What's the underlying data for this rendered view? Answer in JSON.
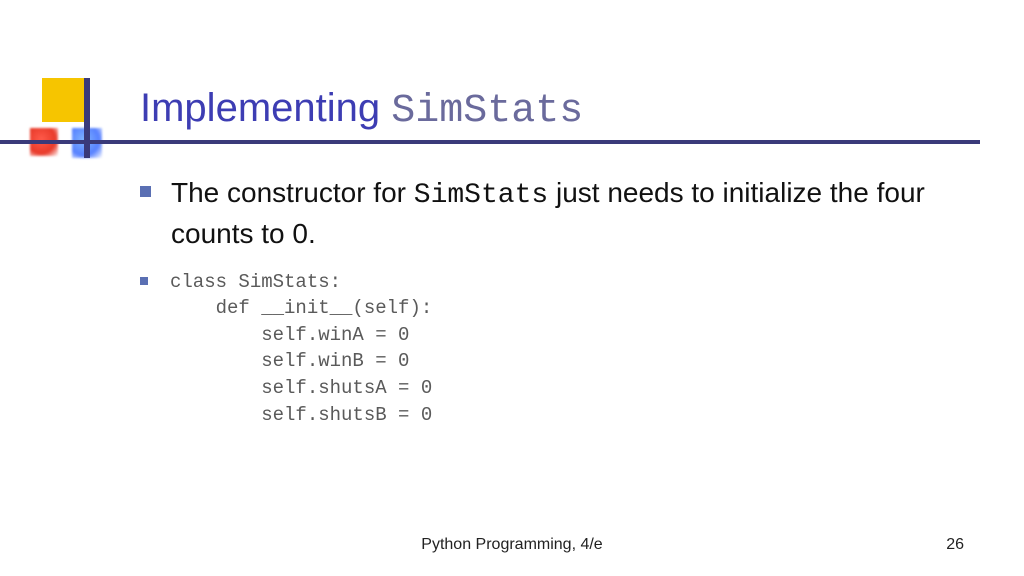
{
  "title": {
    "prefix": "Implementing ",
    "mono": "SimStats"
  },
  "bullets": {
    "main": {
      "pre": "The constructor for ",
      "mono": "SimStats",
      "post": " just needs to initialize the four counts to 0."
    },
    "code": "class SimStats:\n    def __init__(self):\n        self.winA = 0\n        self.winB = 0\n        self.shutsA = 0\n        self.shutsB = 0"
  },
  "footer": {
    "center": "Python Programming, 4/e",
    "page": "26"
  }
}
